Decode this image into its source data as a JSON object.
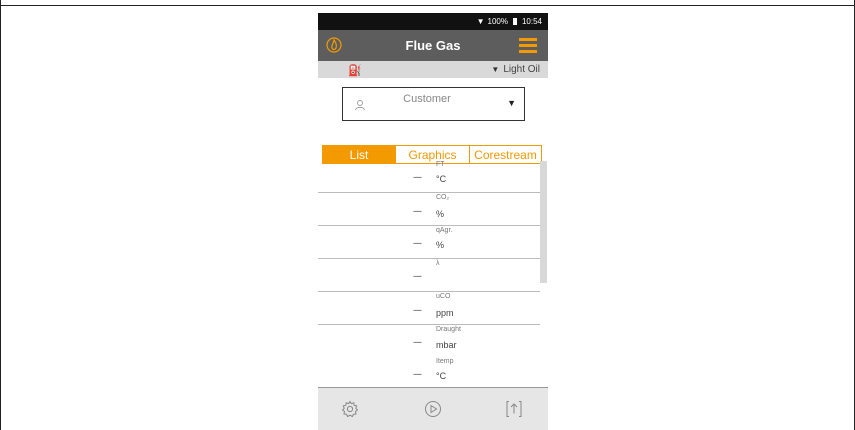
{
  "status": {
    "battery": "100%",
    "time": "10:54"
  },
  "header": {
    "title": "Flue Gas"
  },
  "fuel": {
    "selected": "Light Oil"
  },
  "customer": {
    "placeholder": "Customer"
  },
  "tabs": [
    {
      "label": "List",
      "active": true
    },
    {
      "label": "Graphics",
      "active": false
    },
    {
      "label": "Corestream",
      "active": false
    }
  ],
  "measurements": [
    {
      "value": "----",
      "param": "FT",
      "unit": "°C"
    },
    {
      "value": "----",
      "param": "CO₂",
      "unit": "%"
    },
    {
      "value": "----",
      "param": "qAgr.",
      "unit": "%"
    },
    {
      "value": "----",
      "param": "λ",
      "unit": ""
    },
    {
      "value": "----",
      "param": "uCO",
      "unit": "ppm"
    },
    {
      "value": "----",
      "param": "Draught",
      "unit": "mbar"
    },
    {
      "value": "----",
      "param": "Itemp",
      "unit": "°C"
    }
  ],
  "colors": {
    "accent": "#f29a00",
    "appbar": "#5d5d5d",
    "statusbar": "#111111"
  },
  "icons": {
    "app": "flame-icon",
    "menu": "menu-icon",
    "fuel": "fuel-icon",
    "customer": "person-icon",
    "settings": "gear-icon",
    "start": "play-circle-icon",
    "export": "export-icon"
  }
}
